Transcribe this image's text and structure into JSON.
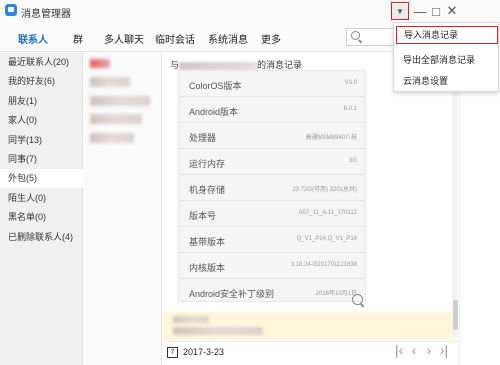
{
  "window": {
    "title": "消息管理器",
    "icons": [
      "app-icon",
      "dropdown-arrow-icon",
      "minimize-icon",
      "maximize-icon",
      "close-icon"
    ]
  },
  "nav": {
    "tabs": [
      {
        "label": "联系人",
        "active": true
      },
      {
        "label": "群",
        "active": false
      },
      {
        "label": "多人聊天",
        "active": false
      },
      {
        "label": "临时会话",
        "active": false
      },
      {
        "label": "系统消息",
        "active": false
      },
      {
        "label": "更多",
        "active": false
      }
    ],
    "search_placeholder": ""
  },
  "sidebar": {
    "items": [
      {
        "label": "最近联系人(20)",
        "active": false
      },
      {
        "label": "我的好友(6)",
        "active": false
      },
      {
        "label": "朋友(1)",
        "active": false
      },
      {
        "label": "家人(0)",
        "active": false
      },
      {
        "label": "同学(13)",
        "active": false
      },
      {
        "label": "同事(7)",
        "active": false
      },
      {
        "label": "外包(5)",
        "active": true
      },
      {
        "label": "陌生人(0)",
        "active": false
      },
      {
        "label": "黑名单(0)",
        "active": false
      },
      {
        "label": "已删除联系人(4)",
        "active": false
      }
    ]
  },
  "chat": {
    "header_prefix": "与",
    "header_suffix": "的消息记录",
    "info_rows": [
      {
        "key": "ColorOS版本",
        "value": "V3.0"
      },
      {
        "key": "Android版本",
        "value": "6.0.1"
      },
      {
        "key": "处理器",
        "value": "高通MSM8940八核"
      },
      {
        "key": "运行内存",
        "value": "3G"
      },
      {
        "key": "机身存储",
        "value": "23.72G(可用)  32G(总共)"
      },
      {
        "key": "版本号",
        "value": "A57_11_A.11_170112"
      },
      {
        "key": "基带版本",
        "value": "Q_V1_P14,Q_V1_P14"
      },
      {
        "key": "内核版本",
        "value": "3.18.24-G201701121638"
      },
      {
        "key": "Android安全补丁级别",
        "value": "2016年10月1日"
      }
    ],
    "date": "2017-3-23",
    "calendar_day": "7"
  },
  "dropdown_menu": {
    "items": [
      {
        "label": "导入消息记录",
        "highlighted": true
      },
      {
        "label": "导出全部消息记录",
        "highlighted": false
      },
      {
        "label": "云消息设置",
        "highlighted": false
      }
    ]
  },
  "colors": {
    "accent": "#1f6fc7",
    "highlight_border": "#e02020",
    "message_bg": "#fff6dc"
  }
}
